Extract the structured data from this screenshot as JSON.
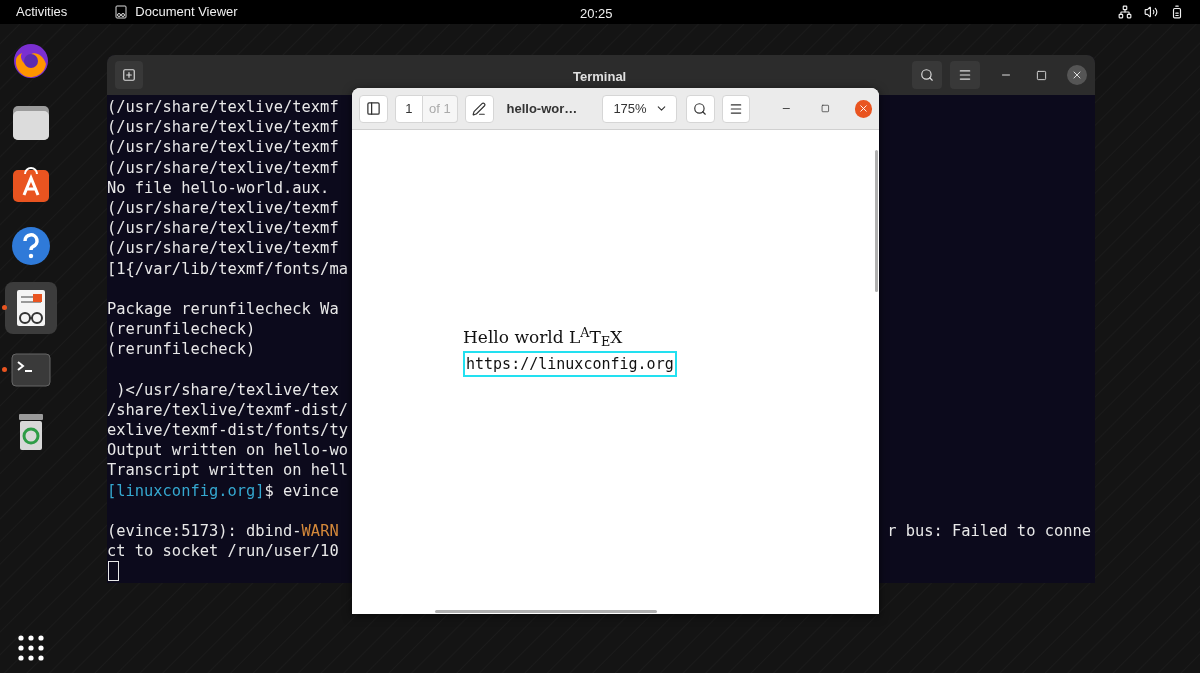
{
  "top_bar": {
    "activities": "Activities",
    "app_menu": "Document Viewer",
    "clock": "20:25"
  },
  "dock": {
    "items": [
      {
        "kind": "firefox",
        "running": false,
        "selected": false
      },
      {
        "kind": "files",
        "running": false,
        "selected": false
      },
      {
        "kind": "store",
        "running": false,
        "selected": false
      },
      {
        "kind": "help",
        "running": false,
        "selected": false
      },
      {
        "kind": "viewer",
        "running": true,
        "selected": true
      },
      {
        "kind": "terminal",
        "running": true,
        "selected": false
      },
      {
        "kind": "trash",
        "running": false,
        "selected": false
      }
    ]
  },
  "terminal": {
    "title": "Terminal",
    "lines": [
      {
        "segments": [
          {
            "text": "(/usr/share/texlive/texmf",
            "kind": "plain"
          }
        ]
      },
      {
        "segments": [
          {
            "text": "(/usr/share/texlive/texmf",
            "kind": "plain"
          }
        ]
      },
      {
        "segments": [
          {
            "text": "(/usr/share/texlive/texmf",
            "kind": "plain"
          }
        ]
      },
      {
        "segments": [
          {
            "text": "(/usr/share/texlive/texmf",
            "kind": "plain"
          }
        ]
      },
      {
        "segments": [
          {
            "text": "No file hello-world.aux.",
            "kind": "plain"
          }
        ]
      },
      {
        "segments": [
          {
            "text": "(/usr/share/texlive/texmf",
            "kind": "plain"
          }
        ]
      },
      {
        "segments": [
          {
            "text": "(/usr/share/texlive/texmf",
            "kind": "plain"
          }
        ]
      },
      {
        "segments": [
          {
            "text": "(/usr/share/texlive/texmf",
            "kind": "plain"
          }
        ]
      },
      {
        "segments": [
          {
            "text": "[1{/var/lib/texmf/fonts/ma",
            "kind": "plain"
          }
        ]
      },
      {
        "gap_before": true,
        "segments": [
          {
            "text": "Package rerunfilecheck Wa",
            "kind": "plain"
          }
        ]
      },
      {
        "segments": [
          {
            "text": "(rerunfilecheck)",
            "kind": "plain"
          }
        ]
      },
      {
        "segments": [
          {
            "text": "(rerunfilecheck)",
            "kind": "plain"
          }
        ]
      },
      {
        "gap_before": true,
        "segments": [
          {
            "text": " )</usr/share/texlive/tex",
            "kind": "plain"
          }
        ]
      },
      {
        "segments": [
          {
            "text": "/share/texlive/texmf-dist/",
            "kind": "plain"
          }
        ]
      },
      {
        "segments": [
          {
            "text": "exlive/texmf-dist/fonts/ty",
            "kind": "plain"
          }
        ]
      },
      {
        "segments": [
          {
            "text": "Output written on hello-wo",
            "kind": "plain"
          }
        ]
      },
      {
        "segments": [
          {
            "text": "Transcript written on hell",
            "kind": "plain"
          }
        ]
      },
      {
        "segments": [
          {
            "text": "[linuxconfig.org]",
            "kind": "prompt"
          },
          {
            "text": "$ evince",
            "kind": "plain"
          }
        ]
      },
      {
        "gap_before": true,
        "segments": [
          {
            "text": "(evince:5173): dbind-",
            "kind": "plain"
          },
          {
            "text": "WARN",
            "kind": "warning"
          }
        ],
        "tail": "r bus: Failed to conne"
      },
      {
        "segments": [
          {
            "text": "ct to socket /run/user/10",
            "kind": "plain"
          }
        ]
      }
    ],
    "cursor": true
  },
  "viewer": {
    "page": "1",
    "page_count": "of 1",
    "title": "hello-wor…",
    "zoom": "175%",
    "document": {
      "heading": "Hello world L$^{A}$T$_{E}$X",
      "link": "https://linuxconfig.org"
    }
  }
}
